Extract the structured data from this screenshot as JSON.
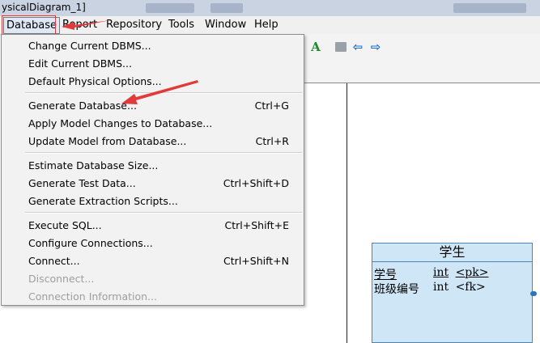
{
  "window": {
    "title": "ysicalDiagram_1]"
  },
  "menubar": {
    "items": [
      {
        "label": "Database",
        "active": true
      },
      {
        "label": "Report"
      },
      {
        "label": "Repository"
      },
      {
        "label": "Tools"
      },
      {
        "label": "Window"
      },
      {
        "label": "Help"
      }
    ]
  },
  "dropdown": {
    "items": [
      {
        "label": "Change Current DBMS...",
        "shortcut": ""
      },
      {
        "label": "Edit Current DBMS...",
        "shortcut": ""
      },
      {
        "label": "Default Physical Options...",
        "shortcut": ""
      },
      {
        "label": "Generate Database...",
        "shortcut": "Ctrl+G"
      },
      {
        "label": "Apply Model Changes to Database...",
        "shortcut": ""
      },
      {
        "label": "Update Model from Database...",
        "shortcut": "Ctrl+R"
      },
      {
        "label": "Estimate Database Size...",
        "shortcut": ""
      },
      {
        "label": "Generate Test Data...",
        "shortcut": "Ctrl+Shift+D"
      },
      {
        "label": "Generate Extraction Scripts...",
        "shortcut": ""
      },
      {
        "label": "Execute SQL...",
        "shortcut": "Ctrl+Shift+E"
      },
      {
        "label": "Configure Connections...",
        "shortcut": ""
      },
      {
        "label": "Connect...",
        "shortcut": "Ctrl+Shift+N"
      },
      {
        "label": "Disconnect...",
        "shortcut": "",
        "disabled": true
      },
      {
        "label": "Connection Information...",
        "shortcut": "",
        "disabled": true
      }
    ]
  },
  "toolbar": {
    "icons": [
      "text-a-icon",
      "folder-icon",
      "arrow-left-icon",
      "arrow-right-icon"
    ],
    "a_glyph": "A"
  },
  "entity": {
    "title": "学生",
    "columns": [
      {
        "name": "学号",
        "type": "int",
        "key": "<pk>",
        "underline": true
      },
      {
        "name": "班级编号",
        "type": "int",
        "key": "<fk>",
        "underline": false
      }
    ]
  },
  "colors": {
    "annotation_red": "#e03a3a",
    "entity_fill": "#cfe6f7",
    "entity_border": "#4a86b8"
  }
}
